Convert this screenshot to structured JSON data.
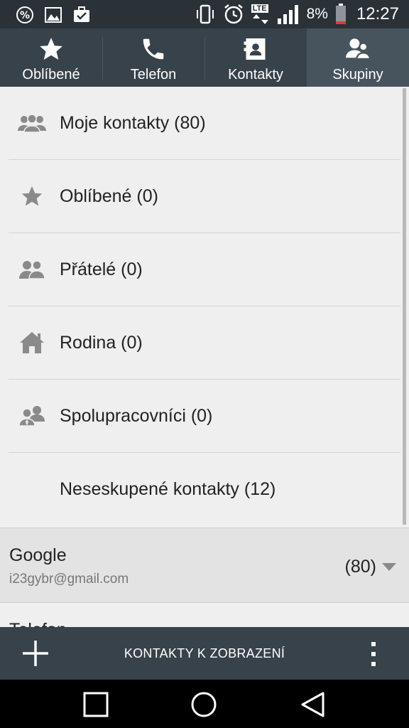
{
  "status_bar": {
    "battery_percent": "8%",
    "time": "12:27",
    "network": "LTE",
    "icons": [
      "percent-badge-icon",
      "image-icon",
      "briefcase-check-icon",
      "vibrate-icon",
      "alarm-icon",
      "lte-icon",
      "signal-icon",
      "battery-low-icon"
    ]
  },
  "tabs": [
    {
      "label": "Oblíbené",
      "icon": "star-icon",
      "active": false
    },
    {
      "label": "Telefon",
      "icon": "phone-icon",
      "active": false
    },
    {
      "label": "Kontakty",
      "icon": "contact-card-icon",
      "active": false
    },
    {
      "label": "Skupiny",
      "icon": "group-icon",
      "active": true
    }
  ],
  "groups": [
    {
      "label": "Moje kontakty (80)",
      "icon": "my-contacts-icon"
    },
    {
      "label": "Oblíbené (0)",
      "icon": "star-icon"
    },
    {
      "label": "Přátelé (0)",
      "icon": "friends-icon"
    },
    {
      "label": "Rodina (0)",
      "icon": "home-icon"
    },
    {
      "label": "Spolupracovníci (0)",
      "icon": "coworkers-icon"
    },
    {
      "label": "Neseskupené kontakty (12)",
      "icon": ""
    }
  ],
  "account": {
    "name": "Google",
    "email": "i23gybr@gmail.com",
    "count": "(80)"
  },
  "next_account": {
    "name": "Telefon"
  },
  "action_bar": {
    "display_label": "KONTAKTY K ZOBRAZENÍ"
  },
  "colors": {
    "status_bar": "#2a3137",
    "tab_bar": "#37424a",
    "tab_active": "#48545d",
    "list_bg": "#efefef",
    "account_bg": "#e3e3e3",
    "icon_gray": "#8a8a8a",
    "battery_low": "#e53935"
  }
}
